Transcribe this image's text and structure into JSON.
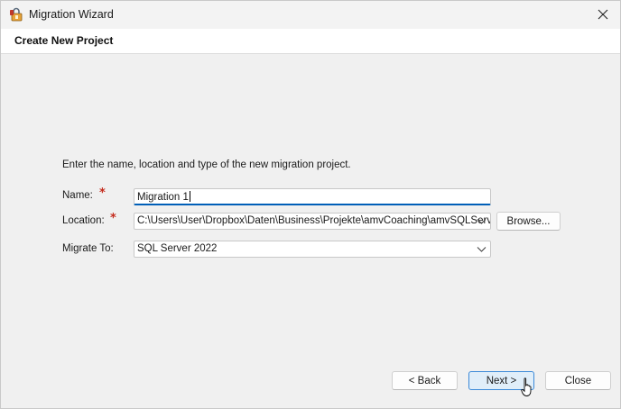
{
  "window": {
    "title": "Migration Wizard"
  },
  "header": {
    "title": "Create New Project"
  },
  "main": {
    "instructions": "Enter the name, location and type of the new migration project.",
    "name_field": {
      "label": "Name:",
      "required_mark": "*",
      "value": "Migration 1"
    },
    "location_field": {
      "label": "Location:",
      "required_mark": "*",
      "value": "C:\\Users\\User\\Dropbox\\Daten\\Business\\Projekte\\amvCoaching\\amvSQLServ"
    },
    "migrate_to_field": {
      "label": "Migrate To:",
      "value": "SQL Server 2022"
    },
    "browse_label": "Browse..."
  },
  "footer": {
    "back_label": "< Back",
    "next_label": "Next >",
    "close_label": "Close"
  },
  "icons": {
    "app": "migration-wizard-app-icon",
    "window_close": "close-icon",
    "dropdown": "chevron-down-icon",
    "pointer": "mouse-pointer-icon"
  },
  "colors": {
    "focus_underline": "#005fb8",
    "required": "#c42b1c",
    "default_button_border": "#3c8ad8"
  }
}
